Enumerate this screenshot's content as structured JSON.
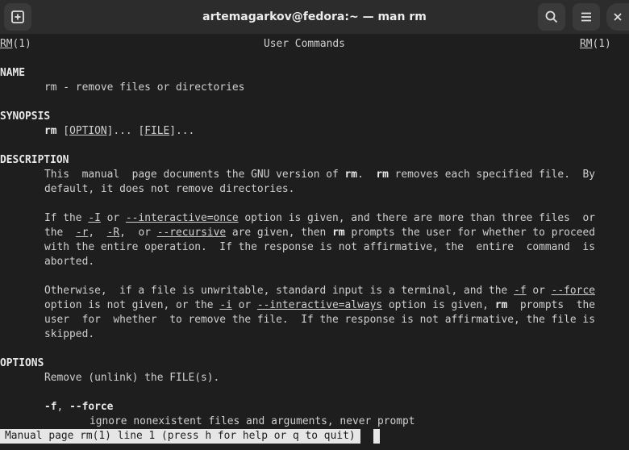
{
  "window": {
    "title": "artemagarkov@fedora:~ — man rm",
    "new_tab_icon": "new-tab-icon",
    "search_icon": "search-icon",
    "menu_icon": "hamburger-menu-icon",
    "close_icon": "close-icon"
  },
  "man": {
    "header_left_name": "RM",
    "header_left_section": "(1)",
    "header_center": "User Commands",
    "header_right_name": "RM",
    "header_right_section": "(1)",
    "name_heading": "NAME",
    "name_text": "rm - remove files or directories",
    "synopsis_heading": "SYNOPSIS",
    "synopsis_cmd": "rm",
    "synopsis_option": "OPTION",
    "synopsis_mid": "]... [",
    "synopsis_file": "FILE",
    "synopsis_end": "]...",
    "description_heading": "DESCRIPTION",
    "d1_a": "This  manual  page documents the GNU version of ",
    "d1_rm1": "rm",
    "d1_b": ".  ",
    "d1_rm2": "rm",
    "d1_c": " removes each specified file.  By",
    "d2": "default, it does not remove directories.",
    "d3_a": "If the ",
    "d3_i": "-I",
    "d3_b": " or ",
    "d3_inter": "--interactive=once",
    "d3_c": " option is given, and there are more than three files  or",
    "d4_a": "the  ",
    "d4_r": "-r",
    "d4_b": ",  ",
    "d4_R": "-R",
    "d4_c": ",  or ",
    "d4_rec": "--recursive",
    "d4_d": " are given, then ",
    "d4_rm": "rm",
    "d4_e": " prompts the user for whether to proceed",
    "d5": "with the entire operation.  If the response is not affirmative, the  entire  command  is",
    "d6": "aborted.",
    "d7_a": "Otherwise,  if a file is unwritable, standard input is a terminal, and the ",
    "d7_f": "-f",
    "d7_b": " or ",
    "d7_force": "--force",
    "d8_a": "option is not given, or the ",
    "d8_i": "-i",
    "d8_b": " or ",
    "d8_always": "--interactive=always",
    "d8_c": " option is given, ",
    "d8_rm": "rm",
    "d8_d": "  prompts  the",
    "d9": "user  for  whether  to remove the file.  If the response is not affirmative, the file is",
    "d10": "skipped.",
    "options_heading": "OPTIONS",
    "opt_desc": "Remove (unlink) the FILE(s).",
    "opt_f_short": "-f",
    "opt_f_sep": ", ",
    "opt_f_long": "--force",
    "opt_f_desc": "ignore nonexistent files and arguments, never prompt"
  },
  "status": {
    "text": "Manual page rm(1) line 1 (press h for help or q to quit)"
  },
  "colors": {
    "background": "#1e1e1e",
    "titlebar": "#2c2c2c",
    "text": "#d0d0d0",
    "statusbar_bg": "#e6e6e6"
  }
}
